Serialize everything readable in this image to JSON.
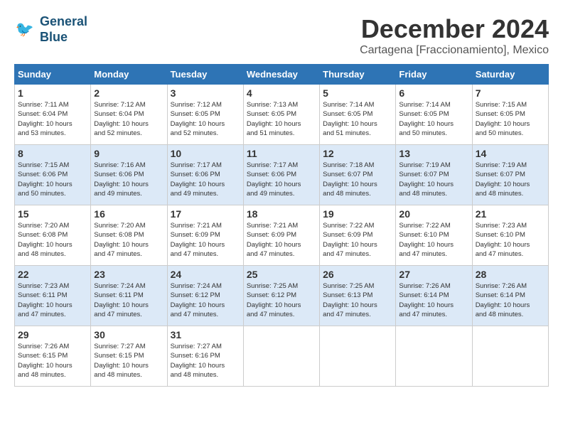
{
  "header": {
    "logo": {
      "line1": "General",
      "line2": "Blue"
    },
    "title": "December 2024",
    "location": "Cartagena [Fraccionamiento], Mexico"
  },
  "weekdays": [
    "Sunday",
    "Monday",
    "Tuesday",
    "Wednesday",
    "Thursday",
    "Friday",
    "Saturday"
  ],
  "weeks": [
    [
      {
        "day": "1",
        "sunrise": "7:11 AM",
        "sunset": "6:04 PM",
        "daylight": "10 hours and 53 minutes."
      },
      {
        "day": "2",
        "sunrise": "7:12 AM",
        "sunset": "6:04 PM",
        "daylight": "10 hours and 52 minutes."
      },
      {
        "day": "3",
        "sunrise": "7:12 AM",
        "sunset": "6:05 PM",
        "daylight": "10 hours and 52 minutes."
      },
      {
        "day": "4",
        "sunrise": "7:13 AM",
        "sunset": "6:05 PM",
        "daylight": "10 hours and 51 minutes."
      },
      {
        "day": "5",
        "sunrise": "7:14 AM",
        "sunset": "6:05 PM",
        "daylight": "10 hours and 51 minutes."
      },
      {
        "day": "6",
        "sunrise": "7:14 AM",
        "sunset": "6:05 PM",
        "daylight": "10 hours and 50 minutes."
      },
      {
        "day": "7",
        "sunrise": "7:15 AM",
        "sunset": "6:05 PM",
        "daylight": "10 hours and 50 minutes."
      }
    ],
    [
      {
        "day": "8",
        "sunrise": "7:15 AM",
        "sunset": "6:06 PM",
        "daylight": "10 hours and 50 minutes."
      },
      {
        "day": "9",
        "sunrise": "7:16 AM",
        "sunset": "6:06 PM",
        "daylight": "10 hours and 49 minutes."
      },
      {
        "day": "10",
        "sunrise": "7:17 AM",
        "sunset": "6:06 PM",
        "daylight": "10 hours and 49 minutes."
      },
      {
        "day": "11",
        "sunrise": "7:17 AM",
        "sunset": "6:06 PM",
        "daylight": "10 hours and 49 minutes."
      },
      {
        "day": "12",
        "sunrise": "7:18 AM",
        "sunset": "6:07 PM",
        "daylight": "10 hours and 48 minutes."
      },
      {
        "day": "13",
        "sunrise": "7:19 AM",
        "sunset": "6:07 PM",
        "daylight": "10 hours and 48 minutes."
      },
      {
        "day": "14",
        "sunrise": "7:19 AM",
        "sunset": "6:07 PM",
        "daylight": "10 hours and 48 minutes."
      }
    ],
    [
      {
        "day": "15",
        "sunrise": "7:20 AM",
        "sunset": "6:08 PM",
        "daylight": "10 hours and 48 minutes."
      },
      {
        "day": "16",
        "sunrise": "7:20 AM",
        "sunset": "6:08 PM",
        "daylight": "10 hours and 47 minutes."
      },
      {
        "day": "17",
        "sunrise": "7:21 AM",
        "sunset": "6:09 PM",
        "daylight": "10 hours and 47 minutes."
      },
      {
        "day": "18",
        "sunrise": "7:21 AM",
        "sunset": "6:09 PM",
        "daylight": "10 hours and 47 minutes."
      },
      {
        "day": "19",
        "sunrise": "7:22 AM",
        "sunset": "6:09 PM",
        "daylight": "10 hours and 47 minutes."
      },
      {
        "day": "20",
        "sunrise": "7:22 AM",
        "sunset": "6:10 PM",
        "daylight": "10 hours and 47 minutes."
      },
      {
        "day": "21",
        "sunrise": "7:23 AM",
        "sunset": "6:10 PM",
        "daylight": "10 hours and 47 minutes."
      }
    ],
    [
      {
        "day": "22",
        "sunrise": "7:23 AM",
        "sunset": "6:11 PM",
        "daylight": "10 hours and 47 minutes."
      },
      {
        "day": "23",
        "sunrise": "7:24 AM",
        "sunset": "6:11 PM",
        "daylight": "10 hours and 47 minutes."
      },
      {
        "day": "24",
        "sunrise": "7:24 AM",
        "sunset": "6:12 PM",
        "daylight": "10 hours and 47 minutes."
      },
      {
        "day": "25",
        "sunrise": "7:25 AM",
        "sunset": "6:12 PM",
        "daylight": "10 hours and 47 minutes."
      },
      {
        "day": "26",
        "sunrise": "7:25 AM",
        "sunset": "6:13 PM",
        "daylight": "10 hours and 47 minutes."
      },
      {
        "day": "27",
        "sunrise": "7:26 AM",
        "sunset": "6:14 PM",
        "daylight": "10 hours and 47 minutes."
      },
      {
        "day": "28",
        "sunrise": "7:26 AM",
        "sunset": "6:14 PM",
        "daylight": "10 hours and 48 minutes."
      }
    ],
    [
      {
        "day": "29",
        "sunrise": "7:26 AM",
        "sunset": "6:15 PM",
        "daylight": "10 hours and 48 minutes."
      },
      {
        "day": "30",
        "sunrise": "7:27 AM",
        "sunset": "6:15 PM",
        "daylight": "10 hours and 48 minutes."
      },
      {
        "day": "31",
        "sunrise": "7:27 AM",
        "sunset": "6:16 PM",
        "daylight": "10 hours and 48 minutes."
      },
      null,
      null,
      null,
      null
    ]
  ],
  "labels": {
    "sunrise": "Sunrise:",
    "sunset": "Sunset:",
    "daylight": "Daylight:"
  }
}
